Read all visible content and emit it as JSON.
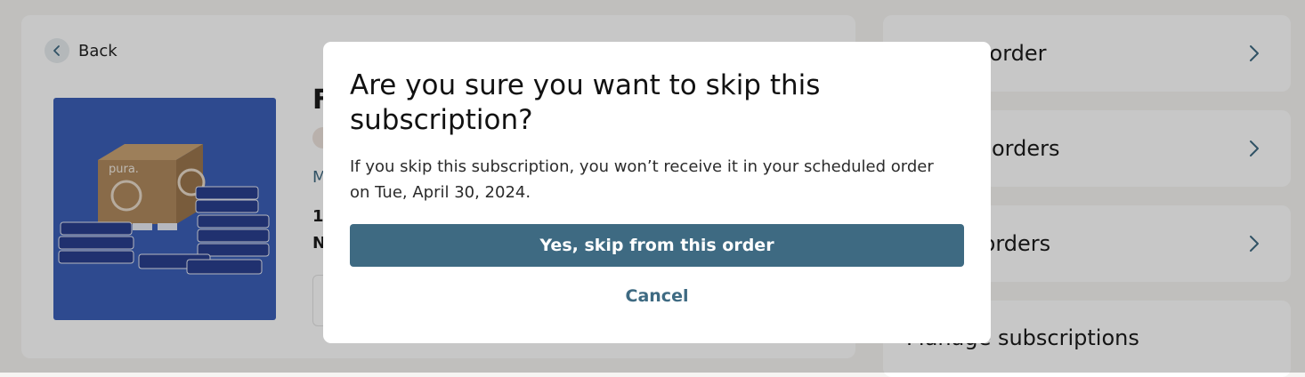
{
  "page": {
    "back_label": "Back",
    "product": {
      "title_partial": "F",
      "link_partial": "M",
      "qty_partial": "1",
      "next_partial": "N",
      "brand_text": "pura."
    }
  },
  "sidebar": {
    "items": [
      {
        "label": "ur next order"
      },
      {
        "label": "coming orders"
      },
      {
        "label": "evious orders"
      },
      {
        "label": "Manage subscriptions"
      }
    ]
  },
  "modal": {
    "title": "Are you sure you want to skip this subscription?",
    "body": "If you skip this subscription, you won’t receive it in your scheduled order on Tue, April 30, 2024.",
    "confirm_label": "Yes, skip from this order",
    "cancel_label": "Cancel"
  },
  "colors": {
    "accent": "#3e6a82",
    "overlay": "rgba(0,0,0,0.22)",
    "product_bg": "#3b5fb8"
  }
}
